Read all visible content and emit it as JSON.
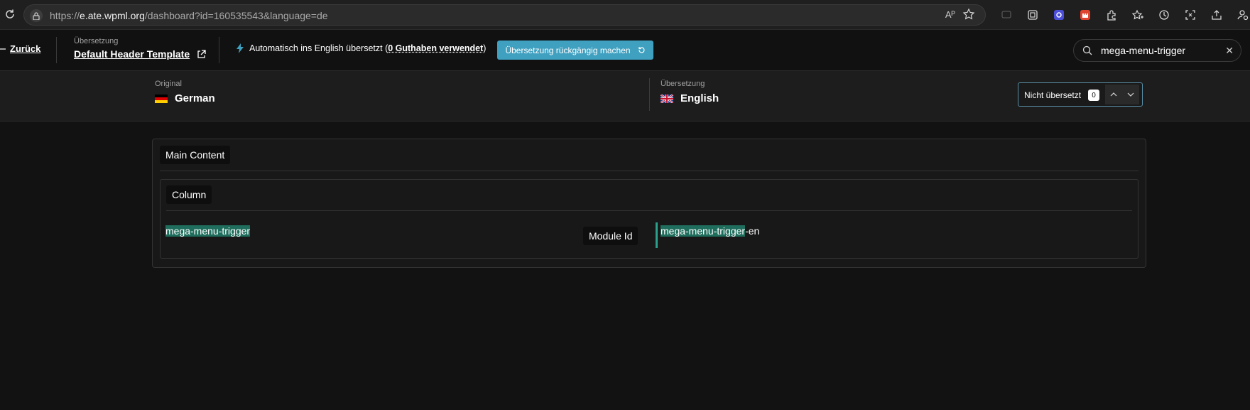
{
  "browser": {
    "url_scheme": "https://",
    "url_host": "e.ate.wpml.org",
    "url_path": "/dashboard?id=160535543&language=de",
    "read_aloud_label": "Aᴾ"
  },
  "header": {
    "back_label": "Zurück",
    "translation_small_label": "Übersetzung",
    "job_title": "Default Header Template",
    "auto_text_prefix": "Automatisch ins English übersetzt (",
    "auto_credits": "0 Guthaben verwendet",
    "auto_text_suffix": ")",
    "undo_button_label": "Übersetzung rückgängig machen",
    "search_value": "mega-menu-trigger",
    "accent_color": "#3fa0c0"
  },
  "languages": {
    "source_small_label": "Original",
    "source_name": "German",
    "target_small_label": "Übersetzung",
    "target_name": "English",
    "filter_label": "Nicht übersetzt",
    "filter_count": "0"
  },
  "content": {
    "section_label": "Main Content",
    "column_label": "Column",
    "field_label": "Module Id",
    "source_text": "mega-menu-trigger",
    "target_highlight": "mega-menu-trigger",
    "target_suffix": "-en",
    "highlight_color": "#1f6e5d"
  }
}
